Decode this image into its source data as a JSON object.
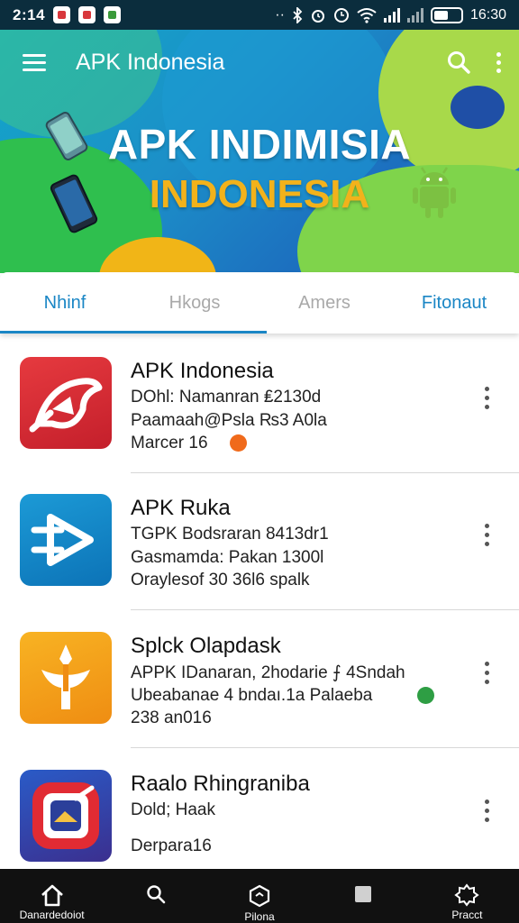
{
  "status_bar": {
    "time": "2:14",
    "clock": "16:30",
    "notification_colors": [
      "#d8373c",
      "#d8373c",
      "#3a9a3a"
    ],
    "battery_level": 0.55
  },
  "header": {
    "title": "APK Indonesia",
    "search_icon": "search-icon",
    "more_icon": "more-vert-icon"
  },
  "banner": {
    "headline": "APK INDIMISIA",
    "subheadline": "INDONESIA"
  },
  "tabs": [
    {
      "label": "Nhinf",
      "active": true
    },
    {
      "label": "Hkogs",
      "active": false
    },
    {
      "label": "Amers",
      "active": false
    },
    {
      "label": "Fitonaut",
      "active": false
    }
  ],
  "apps": [
    {
      "name": "APK Indonesia",
      "line1": "DOhl: Namanran ₤2130d",
      "line2": "Paamaah@Psla ₨3 A0la",
      "line3": "Marcer 16",
      "icon": "apk-red-icon",
      "status_color": "#f06a1b"
    },
    {
      "name": "APK Ruka",
      "line1": "TGPK Bodsraran 8413dr1",
      "line2": "Gasmamda: Pakan 1300l",
      "line3": "Oraylesof 30 36l6 spalk",
      "icon": "apk-blue-icon",
      "status_color": ""
    },
    {
      "name": "Splck Olapdask",
      "line1": "APPK IDanaran, 2hodarie ⨍ 4Sndah",
      "line2": "Ubeabanae 4 bndaı.1a Palaeba",
      "line3": "238 an016",
      "icon": "apk-orange-icon",
      "status_color": "#2e9e44"
    },
    {
      "name": "Raalo Rhingraniba",
      "line1": "Dold; Haak",
      "line2": "",
      "line3": "Derpara16",
      "icon": "apk-purple-icon",
      "status_color": ""
    }
  ],
  "bottom_nav": [
    {
      "label": "Danardedoiot",
      "icon": "home-icon"
    },
    {
      "label": "",
      "icon": "search-icon"
    },
    {
      "label": "Pilona",
      "icon": "hexagon-icon"
    },
    {
      "label": "",
      "icon": "square-icon"
    },
    {
      "label": "Pracct",
      "icon": "badge-icon"
    }
  ],
  "colors": {
    "accent": "#1a86c5",
    "headline_yellow": "#f2b21b",
    "status_bar": "#0b2d3d"
  }
}
